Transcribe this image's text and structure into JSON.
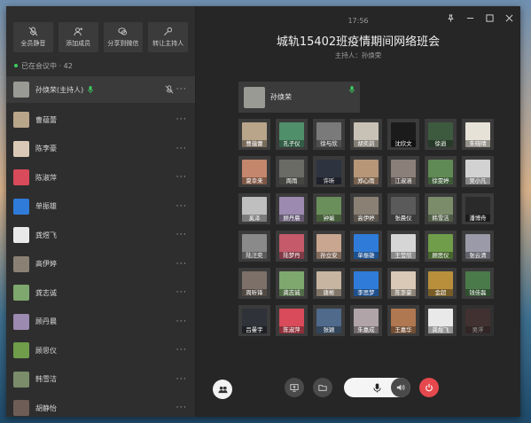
{
  "sidebar": {
    "tools": [
      {
        "label": "全员静音",
        "icon": "mic-mute-icon"
      },
      {
        "label": "添加成员",
        "icon": "add-person-icon"
      },
      {
        "label": "分享到微信",
        "icon": "wechat-icon"
      },
      {
        "label": "转让主持人",
        "icon": "transfer-host-icon"
      }
    ],
    "online_text": "已在会议中 · 42",
    "host": {
      "name": "孙焕荣(主持人)",
      "color": "#9a9a94"
    },
    "members": [
      {
        "name": "曹蕴蕾",
        "color": "#b9a58a"
      },
      {
        "name": "陈李豪",
        "color": "#d9c9b6"
      },
      {
        "name": "陈淑萍",
        "color": "#d94a5a"
      },
      {
        "name": "单振雄",
        "color": "#2f7bd9"
      },
      {
        "name": "龚煜飞",
        "color": "#e9e9e9"
      },
      {
        "name": "高伊婷",
        "color": "#8a8074"
      },
      {
        "name": "龚志诚",
        "color": "#7ea86e"
      },
      {
        "name": "顾丹晨",
        "color": "#9c8ab0"
      },
      {
        "name": "顾思仪",
        "color": "#6f9d4a"
      },
      {
        "name": "韩雪洁",
        "color": "#7a8c6a"
      },
      {
        "name": "胡静怡",
        "color": "#6e5d56"
      }
    ]
  },
  "main": {
    "time": "17:56",
    "title": "城轨15402班疫情期间网络班会",
    "host_line": "主持人：孙焕荣",
    "host_card_name": "孙焕荣",
    "tiles": [
      {
        "name": "曹蕴蕾",
        "color": "#b9a58a"
      },
      {
        "name": "孔子仪",
        "color": "#4f8f6a"
      },
      {
        "name": "徐与欣",
        "color": "#7a7a7a"
      },
      {
        "name": "胡奕韵",
        "color": "#c8c2b6"
      },
      {
        "name": "沈欣文",
        "color": "#1b1b1b"
      },
      {
        "name": "徐逍",
        "color": "#3d5a3e"
      },
      {
        "name": "朱晓晴",
        "color": "#e7e2d8"
      },
      {
        "name": "夏幸来",
        "color": "#c4866c"
      },
      {
        "name": "周雨",
        "color": "#6b6b66"
      },
      {
        "name": "许昕",
        "color": "#2e3340"
      },
      {
        "name": "郑心雨",
        "color": "#b79678"
      },
      {
        "name": "江淑涵",
        "color": "#8a7f79"
      },
      {
        "name": "徐雯婷",
        "color": "#5f8a55"
      },
      {
        "name": "吴小凡",
        "color": "#d2d2d2"
      },
      {
        "name": "奚泽",
        "color": "#bfbfbf"
      },
      {
        "name": "顾丹晨",
        "color": "#9c8ab0"
      },
      {
        "name": "钟瑜",
        "color": "#6a8f5a"
      },
      {
        "name": "高伊婷",
        "color": "#8a8074"
      },
      {
        "name": "张晨仪",
        "color": "#5a5a5a"
      },
      {
        "name": "韩雪洁",
        "color": "#7a8c6a"
      },
      {
        "name": "潘博舟",
        "color": "#2a2a2a"
      },
      {
        "name": "陆汪奕",
        "color": "#8a8a8a"
      },
      {
        "name": "陆梦丹",
        "color": "#c45a6a"
      },
      {
        "name": "孙立安",
        "color": "#c8a690"
      },
      {
        "name": "单振雄",
        "color": "#2f7bd9"
      },
      {
        "name": "王莹欣",
        "color": "#d6d6d6"
      },
      {
        "name": "顾思仪",
        "color": "#6f9d4a"
      },
      {
        "name": "张云清",
        "color": "#9a9aa8"
      },
      {
        "name": "周昕锋",
        "color": "#7d7068"
      },
      {
        "name": "龚志诚",
        "color": "#7ea86e"
      },
      {
        "name": "唐彬",
        "color": "#c7b5a2"
      },
      {
        "name": "李思梦",
        "color": "#2f7bd9"
      },
      {
        "name": "陈李豪",
        "color": "#d9c9b6"
      },
      {
        "name": "金超",
        "color": "#b98f3c"
      },
      {
        "name": "钱佳磊",
        "color": "#4a7a4a"
      },
      {
        "name": "吕曼宇",
        "color": "#2f3238"
      },
      {
        "name": "陈淑萍",
        "color": "#d94a5a"
      },
      {
        "name": "张颖",
        "color": "#4f6a8a"
      },
      {
        "name": "朱嘉成",
        "color": "#b0a4a8"
      },
      {
        "name": "王嘉华",
        "color": "#b07850"
      },
      {
        "name": "龚煜飞",
        "color": "#e9e9e9"
      },
      {
        "name": "吴浮",
        "color": "#5a3a3a",
        "dim": true
      }
    ]
  },
  "colors": {
    "accent_green": "#3ccd60",
    "end_red": "#e5484d",
    "panel": "#2e2e2e",
    "tile": "#3b3b3b"
  }
}
